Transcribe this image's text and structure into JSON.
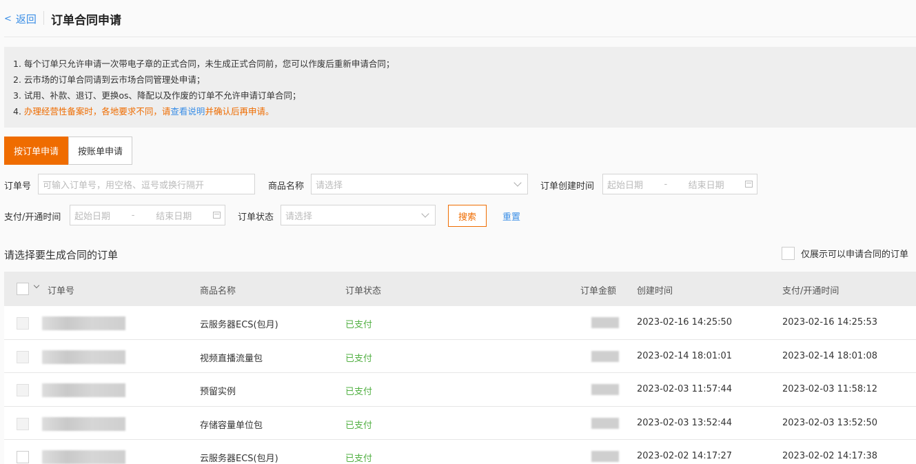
{
  "header": {
    "back_label": "返回",
    "back_chevron": "<",
    "title": "订单合同申请"
  },
  "notice": {
    "line1": "1. 每个订单只允许申请一次带电子章的正式合同，未生成正式合同前，您可以作废后重新申请合同；",
    "line2": "2. 云市场的订单合同请到云市场合同管理处申请；",
    "line3": "3. 试用、补款、退订、更换os、降配以及作废的订单不允许申请订单合同；",
    "line4_prefix": "4. ",
    "line4_warn_a": "办理经营性备案时，各地要求不同，请",
    "line4_link": "查看说明",
    "line4_warn_b": "并确认后再申请。"
  },
  "tabs": [
    {
      "label": "按订单申请",
      "active": true
    },
    {
      "label": "按账单申请",
      "active": false
    }
  ],
  "filters": {
    "order_no_label": "订单号",
    "order_no_placeholder": "可输入订单号，用空格、逗号或换行隔开",
    "product_label": "商品名称",
    "product_placeholder": "请选择",
    "create_time_label": "订单创建时间",
    "start_placeholder": "起始日期",
    "end_placeholder": "结束日期",
    "date_sep": "-",
    "pay_time_label": "支付/开通时间",
    "status_label": "订单状态",
    "status_placeholder": "请选择",
    "search_label": "搜索",
    "reset_label": "重置"
  },
  "section": {
    "title": "请选择要生成合同的订单",
    "only_label": "仅展示可以申请合同的订单"
  },
  "table": {
    "columns": {
      "order_no": "订单号",
      "product": "商品名称",
      "status": "订单状态",
      "amount": "订单金额",
      "created": "创建时间",
      "paid": "支付/开通时间"
    },
    "rows": [
      {
        "product": "云服务器ECS(包月)",
        "status": "已支付",
        "created": "2023-02-16 14:25:50",
        "paid": "2023-02-16 14:25:53"
      },
      {
        "product": "视频直播流量包",
        "status": "已支付",
        "created": "2023-02-14 18:01:01",
        "paid": "2023-02-14 18:01:08"
      },
      {
        "product": "预留实例",
        "status": "已支付",
        "created": "2023-02-03 11:57:44",
        "paid": "2023-02-03 11:58:12"
      },
      {
        "product": "存储容量单位包",
        "status": "已支付",
        "created": "2023-02-03 13:52:44",
        "paid": "2023-02-03 13:52:50"
      },
      {
        "product": "云服务器ECS(包月)",
        "status": "已支付",
        "created": "2023-02-02 14:17:27",
        "paid": "2023-02-02 14:17:38"
      }
    ]
  },
  "colors": {
    "accent": "#ef6c00",
    "link": "#3a8ee6",
    "paid": "#52b043"
  }
}
